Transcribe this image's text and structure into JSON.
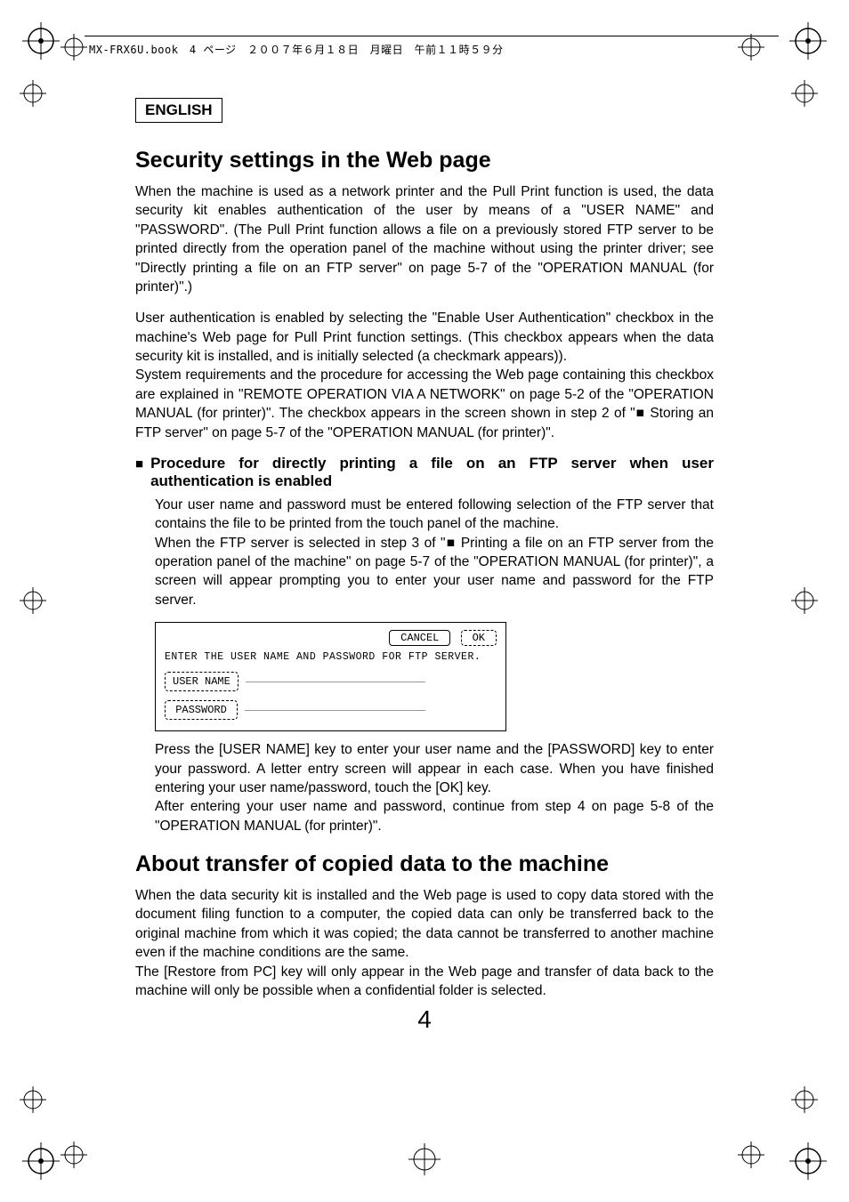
{
  "header": {
    "filemeta": "MX-FRX6U.book　4 ページ　２００７年６月１８日　月曜日　午前１１時５９分"
  },
  "lang_label": "ENGLISH",
  "h1": "Security settings in the Web page",
  "p1": "When the machine is used as a network printer and the Pull Print function is used, the data security kit enables authentication of the user by means of a \"USER NAME\" and \"PASSWORD\". (The Pull Print function allows a file on a previously stored FTP server to be printed directly from the operation panel of the machine without using the printer driver; see \"Directly printing a file on an FTP server\" on page 5-7 of the \"OPERATION MANUAL (for printer)\".)",
  "p2": "User authentication is enabled by selecting the \"Enable User Authentication\" checkbox in the machine's Web page for Pull Print function settings. (This checkbox appears when the data security kit is installed, and is initially selected (a checkmark appears)).",
  "p3": "System requirements and the procedure for accessing the Web page containing this checkbox are explained in \"REMOTE OPERATION VIA A NETWORK\" on page 5-2 of the \"OPERATION MANUAL (for printer)\". The checkbox appears in the screen shown in step 2 of \"■ Storing an FTP server\" on page 5-7 of the \"OPERATION MANUAL (for printer)\".",
  "subhead": "Procedure for directly printing a file on an FTP server when user authentication is enabled",
  "p4": "Your user name and password must be entered following selection of the FTP server that contains the file to be printed from the touch panel of the machine.",
  "p5": "When the FTP server is selected in step 3 of \"■ Printing a file on an FTP server from the operation panel of the machine\" on page 5-7 of the \"OPERATION MANUAL (for printer)\", a screen will appear prompting you to enter your user name and password for the FTP server.",
  "figure": {
    "cancel": "CANCEL",
    "ok": "OK",
    "prompt": "ENTER THE USER NAME AND PASSWORD FOR FTP SERVER.",
    "username": "USER NAME",
    "password": "PASSWORD"
  },
  "p6": "Press the [USER NAME] key to enter your user name and the [PASSWORD] key to enter your password. A letter entry screen will appear in each case. When you have finished entering your user name/password, touch the [OK] key.",
  "p7": "After entering your user name and password, continue from step 4 on page 5-8 of the \"OPERATION MANUAL (for printer)\".",
  "h2": "About transfer of copied data to the machine",
  "p8": "When the data security kit is installed and the Web page is used to copy data stored with the document filing function to a computer, the copied data can only be transferred back to the original machine from which it was copied; the data cannot be transferred to another machine even if the machine conditions are the same.",
  "p9": "The [Restore from PC] key will only appear in the Web page and transfer of data back to the machine will only be possible when a confidential folder is selected.",
  "page_number": "4"
}
